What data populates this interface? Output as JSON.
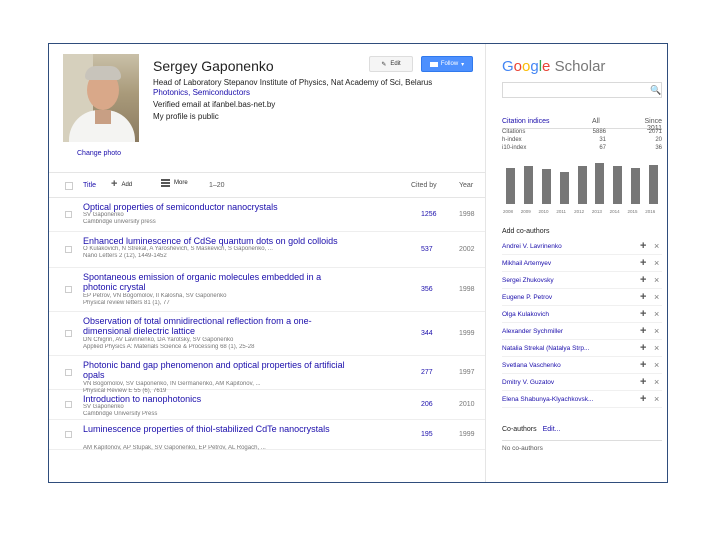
{
  "profile": {
    "name": "Sergey Gaponenko",
    "change_photo": "Change photo",
    "affiliation": "Head of Laboratory Stepanov Institute of Physics, Nat Academy of Sci, Belarus",
    "interests": "Photonics, Semiconductors",
    "email": "Verified email at ifanbel.bas-net.by",
    "public": "My profile is public",
    "edit_label": "Edit",
    "follow_label": "Follow"
  },
  "toolbar": {
    "title": "Title",
    "add": "Add",
    "more": "More",
    "range": "1–20",
    "cited_by": "Cited by",
    "year": "Year"
  },
  "publications": [
    {
      "title": "Optical properties of semiconductor nanocrystals",
      "authors": "SV Gaponenko",
      "venue": "Cambridge university press",
      "cited": "1256",
      "year": "1998"
    },
    {
      "title": "Enhanced luminescence of CdSe quantum dots on gold colloids",
      "authors": "O Kulakovich, N Strekal, A Yaroshevich, S Maskevich, S Gaponenko, ...",
      "venue": "Nano Letters 2 (12), 1449-1452",
      "cited": "537",
      "year": "2002"
    },
    {
      "title": "Spontaneous emission of organic molecules embedded in a photonic crystal",
      "authors": "EP Petrov, VN Bogomolov, II Kalosha, SV Gaponenko",
      "venue": "Physical review letters 81 (1), 77",
      "cited": "356",
      "year": "1998"
    },
    {
      "title": "Observation of total omnidirectional reflection from a one-dimensional dielectric lattice",
      "authors": "DN Chigrin, AV Lavrinenko, DA Yarotsky, SV Gaponenko",
      "venue": "Applied Physics A: Materials Science & Processing 68 (1), 25-28",
      "cited": "344",
      "year": "1999"
    },
    {
      "title": "Photonic band gap phenomenon and optical properties of artificial opals",
      "authors": "VN Bogomolov, SV Gaponenko, IN Germanenko, AM Kapitonov, ...",
      "venue": "Physical Review E 55 (6), 7619",
      "cited": "277",
      "year": "1997"
    },
    {
      "title": "Introduction to nanophotonics",
      "authors": "SV Gaponenko",
      "venue": "Cambridge University Press",
      "cited": "206",
      "year": "2010"
    },
    {
      "title": "Luminescence properties of thiol-stabilized CdTe nanocrystals",
      "authors": "AM Kapitonov, AP Stupak, SV Gaponenko, EP Petrov, AL Rogach, ...",
      "venue": "",
      "cited": "195",
      "year": "1999"
    }
  ],
  "sidebar": {
    "logo_g1": "G",
    "logo_o1": "o",
    "logo_o2": "o",
    "logo_g2": "g",
    "logo_l": "l",
    "logo_e": "e",
    "logo_scholar": "Scholar",
    "search_placeholder": "",
    "search_icon": "🔍",
    "citation_indices": "Citation indices",
    "col_all": "All",
    "col_since": "Since 2011",
    "indices": [
      {
        "label": "Citations",
        "all": "5886",
        "since": "2071"
      },
      {
        "label": "h-index",
        "all": "31",
        "since": "20"
      },
      {
        "label": "i10-index",
        "all": "67",
        "since": "36"
      }
    ],
    "add_coauthors": "Add co-authors",
    "coauthors": [
      "Andrei V. Lavrinenko",
      "Mikhail Artemyev",
      "Sergei Zhukovsky",
      "Eugene P. Petrov",
      "Olga Kulakovich",
      "Alexander Sychmiller",
      "Natalia Strekal (Natalya Strp...",
      "Svetlana Vaschenko",
      "Dmitry V. Guzatov",
      "Elena Shabunya-Klyachkovsk..."
    ],
    "coauthor_add_icon": "+",
    "coauthor_remove_icon": "×",
    "coauthors_footer": "Co-authors",
    "coauthors_edit": "Edit...",
    "no_coauthors": "No co-authors"
  },
  "chart_data": {
    "type": "bar",
    "categories": [
      "2008",
      "2009",
      "2010",
      "2011",
      "2012",
      "2013",
      "2014",
      "2015",
      "2016"
    ],
    "values": [
      310,
      330,
      300,
      280,
      330,
      355,
      330,
      310,
      340
    ],
    "ylim": [
      0,
      380
    ],
    "grid": false,
    "bar_color": "#777777"
  },
  "colors": {
    "link": "#1a0dab",
    "follow_button": "#4d90fe",
    "frame_border": "#2f4d7c"
  }
}
